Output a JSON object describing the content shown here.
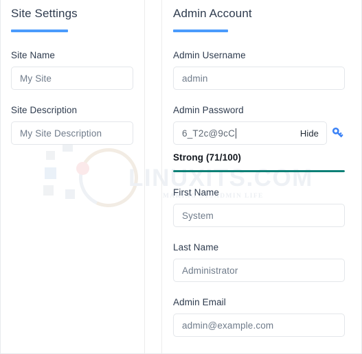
{
  "left_panel": {
    "title": "Site Settings",
    "fields": [
      {
        "label": "Site Name",
        "value": "My Site"
      },
      {
        "label": "Site Description",
        "value": "My Site Description"
      }
    ]
  },
  "right_panel": {
    "title": "Admin Account",
    "username": {
      "label": "Admin Username",
      "value": "admin"
    },
    "password": {
      "label": "Admin Password",
      "value": "6_T2c@9cC",
      "toggle_label": "Hide",
      "generate_icon": "key-icon",
      "strength_text": "Strong (71/100)",
      "strength_score": 71,
      "strength_max": 100,
      "strength_percent": 100,
      "strength_color": "#0b8076"
    },
    "first_name": {
      "label": "First Name",
      "value": "System"
    },
    "last_name": {
      "label": "Last Name",
      "value": "Administrator"
    },
    "email": {
      "label": "Admin Email",
      "value": "admin@example.com"
    }
  },
  "watermark": {
    "text": "LINUXITS.COM",
    "tagline": "MAKING SYSADMIN LIFE"
  },
  "colors": {
    "accent": "#4a9bfc",
    "strength": "#0b8076",
    "key_icon": "#3b82f6",
    "label": "#2e3b4e",
    "border": "#e3e6ea"
  }
}
